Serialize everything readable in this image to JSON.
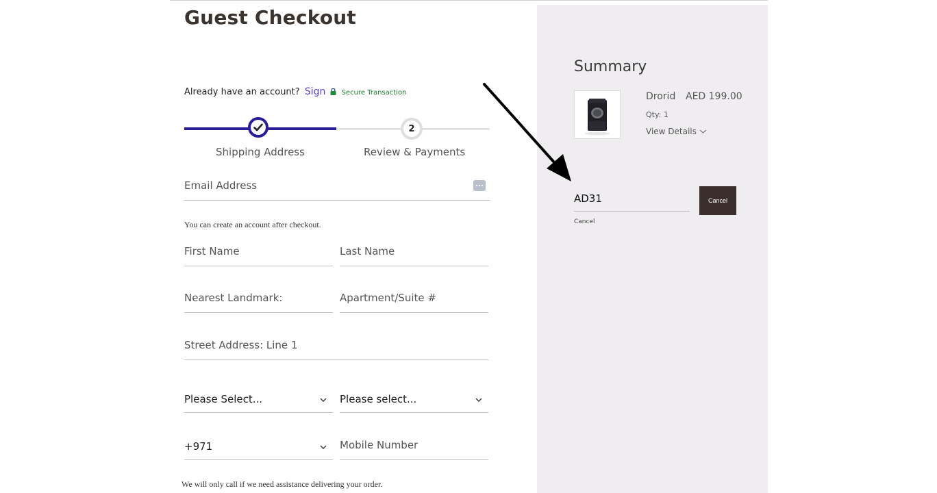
{
  "checkout": {
    "title": "Guest Checkout",
    "account_prompt": "Already have an account?",
    "sign_in_link": "Sign",
    "secure_label": "Secure Transaction",
    "steps": [
      {
        "label": "Shipping Address",
        "state": "completed"
      },
      {
        "number": "2",
        "label": "Review & Payments",
        "state": "pending"
      }
    ],
    "email": {
      "placeholder": "Email Address"
    },
    "email_note": "You can create an account after checkout.",
    "first_name": {
      "placeholder": "First Name"
    },
    "last_name": {
      "placeholder": "Last Name"
    },
    "landmark": {
      "placeholder": "Nearest Landmark:"
    },
    "apartment": {
      "placeholder": "Apartment/Suite #"
    },
    "street": {
      "placeholder": "Street Address: Line 1"
    },
    "select_1": {
      "value": "Please Select..."
    },
    "select_2": {
      "value": "Please select..."
    },
    "phone_code": {
      "value": "+971"
    },
    "mobile": {
      "placeholder": "Mobile Number"
    },
    "phone_note": "We will only call if we need assistance delivering your order."
  },
  "summary": {
    "title": "Summary",
    "item": {
      "name": "Drorid",
      "price": "AED 199.00",
      "qty": "Qty: 1",
      "view_details": "View Details"
    },
    "coupon": {
      "value": "AD31",
      "button_label": "Cancel",
      "cancel_link": "Cancel"
    }
  },
  "colors": {
    "accent": "#2a1d99",
    "link": "#5a3fd0",
    "secure": "#1b7a2a",
    "panel": "#efedf0",
    "button": "#3a2f2c"
  },
  "icons": [
    "check-icon",
    "lock-icon",
    "password-manager-icon",
    "chevron-down-icon",
    "watch-product-image",
    "arrow-annotation"
  ]
}
